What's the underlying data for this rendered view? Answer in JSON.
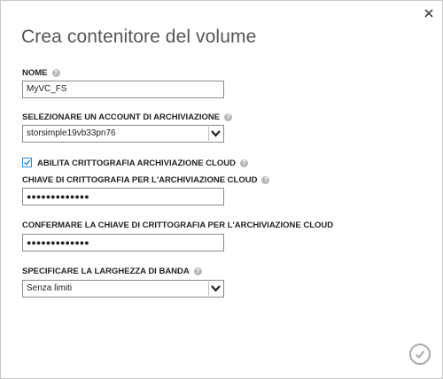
{
  "dialog": {
    "title": "Crea contenitore del volume",
    "close_glyph": "×"
  },
  "fields": {
    "name": {
      "label": "NOME",
      "value": "MyVC_FS"
    },
    "storage_account": {
      "label": "SELEZIONARE UN ACCOUNT DI ARCHIVIAZIONE",
      "value": "storsimple19vb33pn76"
    },
    "encryption": {
      "label": "ABILITA CRITTOGRAFIA ARCHIVIAZIONE CLOUD",
      "checked": true
    },
    "key": {
      "label": "CHIAVE DI CRITTOGRAFIA PER L'ARCHIVIAZIONE CLOUD",
      "value": "●●●●●●●●●●●●●"
    },
    "confirm_key": {
      "label": "CONFERMARE LA CHIAVE DI CRITTOGRAFIA PER L'ARCHIVIAZIONE CLOUD",
      "value": "●●●●●●●●●●●●●"
    },
    "bandwidth": {
      "label": "SPECIFICARE LA LARGHEZZA DI BANDA",
      "value": "Senza limiti"
    }
  },
  "icons": {
    "help": "help-icon",
    "close": "close-icon",
    "confirm": "checkmark-circle-icon",
    "dropdown": "chevron-down-icon"
  },
  "colors": {
    "checkbox": "#2a8bd4",
    "help": "#b8b8b8",
    "confirm": "#a8a8a8"
  },
  "help_glyph": "?"
}
